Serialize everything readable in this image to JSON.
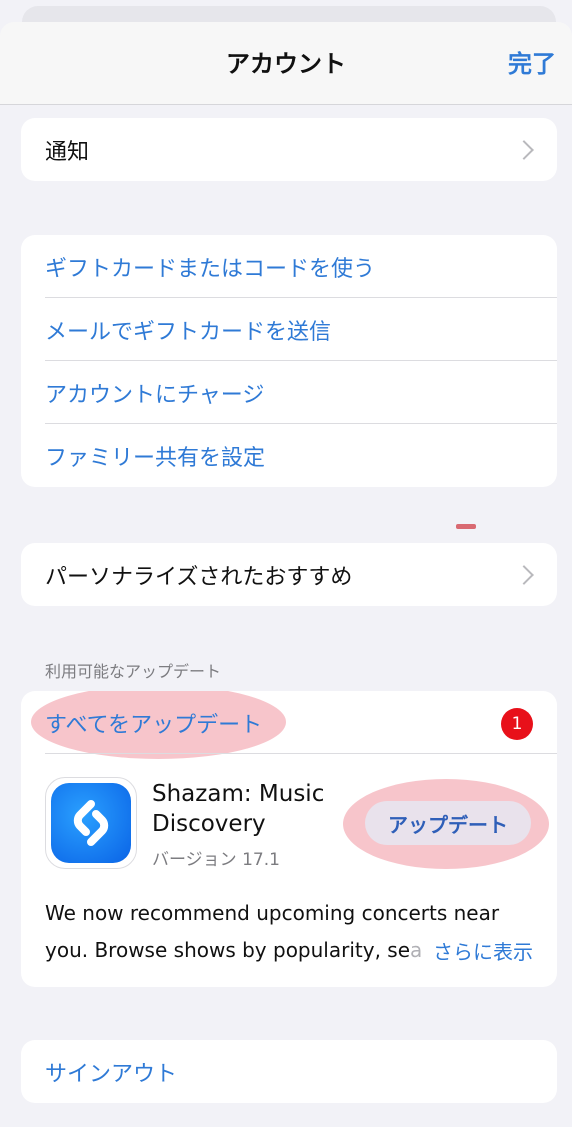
{
  "navbar": {
    "title": "アカウント",
    "done_label": "完了"
  },
  "notifications": {
    "label": "通知"
  },
  "gift_section": {
    "items": [
      {
        "label": "ギフトカードまたはコードを使う"
      },
      {
        "label": "メールでギフトカードを送信"
      },
      {
        "label": "アカウントにチャージ"
      },
      {
        "label": "ファミリー共有を設定"
      }
    ]
  },
  "personalized": {
    "label": "パーソナライズされたおすすめ"
  },
  "updates": {
    "caption": "利用可能なアップデート",
    "update_all_label": "すべてをアップデート",
    "badge_count": "1",
    "app": {
      "name_line1": "Shazam: Music",
      "name_line2": "Discovery",
      "version": "バージョン 17.1",
      "update_button": "アップデート",
      "notes_line1": "We now recommend upcoming concerts near",
      "notes_line2": "you. Browse shows by popularity, se",
      "notes_line2_fade": "a",
      "more_label": "さらに表示"
    }
  },
  "signout": {
    "label": "サインアウト"
  },
  "colors": {
    "accent": "#2f7ad6",
    "badge": "#e8101a",
    "highlight": "#f096a0"
  }
}
